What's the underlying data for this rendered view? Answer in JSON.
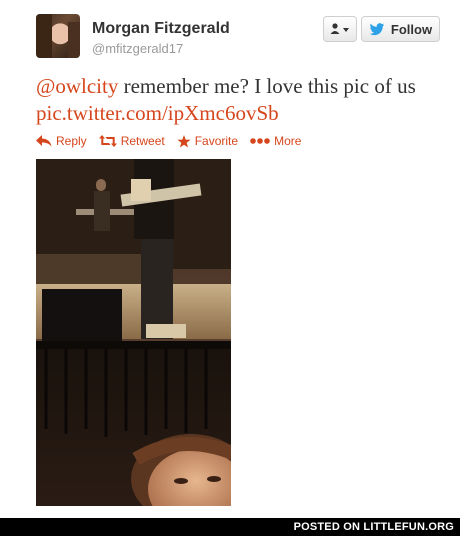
{
  "tweet": {
    "author": {
      "name": "Morgan Fitzgerald",
      "handle": "@mfitzgerald17"
    },
    "buttons": {
      "user_menu_icon": "user-dropdown-icon",
      "follow_label": "Follow",
      "follow_icon": "twitter-bird-icon"
    },
    "text": {
      "mention": "@owlcity",
      "body": " remember me? I love this pic of us",
      "link": "pic.twitter.com/ipXmc6ovSb"
    },
    "actions": [
      {
        "label": "Reply",
        "icon": "reply-arrow-icon"
      },
      {
        "label": "Retweet",
        "icon": "retweet-icon"
      },
      {
        "label": "Favorite",
        "icon": "star-icon"
      },
      {
        "label": "More",
        "icon": "more-dots-icon"
      }
    ],
    "link_color": "#d6461c",
    "follow_icon_color": "#2ea2e8"
  },
  "footer": {
    "text": "POSTED ON LITTLEFUN.ORG"
  }
}
